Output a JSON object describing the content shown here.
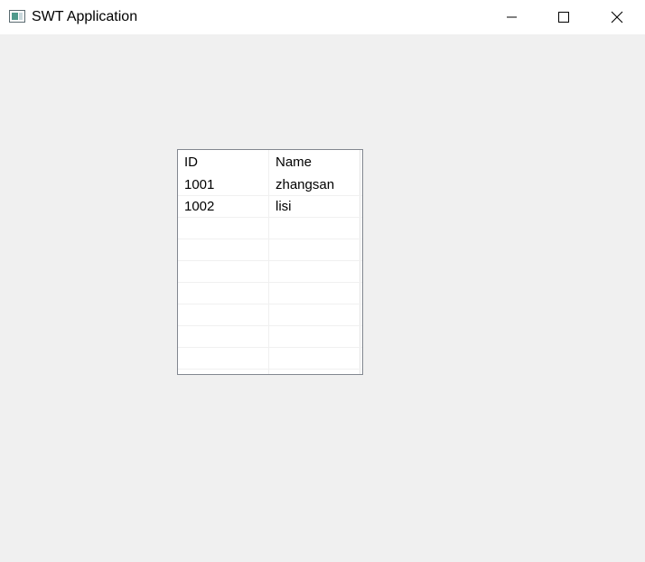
{
  "window": {
    "title": "SWT Application"
  },
  "icons": {
    "app": "app-window-icon",
    "minimize": "minimize-icon",
    "maximize": "maximize-icon",
    "close": "close-icon"
  },
  "table": {
    "columns": [
      "ID",
      "Name"
    ],
    "rows": [
      [
        "1001",
        "zhangsan"
      ],
      [
        "1002",
        "lisi"
      ],
      [
        "",
        ""
      ],
      [
        "",
        ""
      ],
      [
        "",
        ""
      ],
      [
        "",
        ""
      ],
      [
        "",
        ""
      ],
      [
        "",
        ""
      ],
      [
        "",
        ""
      ]
    ]
  }
}
